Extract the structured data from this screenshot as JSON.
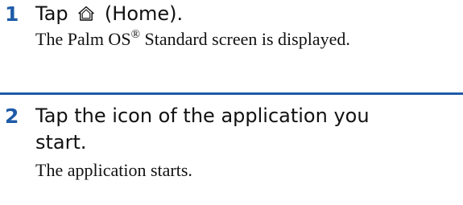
{
  "steps": [
    {
      "number": "1",
      "instruction_prefix": "Tap",
      "instruction_suffix": "(Home).",
      "result_before_mark": "The Palm OS",
      "result_mark": "®",
      "result_after_mark": " Standard screen is displayed.",
      "icon": "home-icon"
    },
    {
      "number": "2",
      "instruction_line1": "Tap the icon of the application you",
      "instruction_line2": "start.",
      "result": "The application starts."
    }
  ],
  "colors": {
    "accent": "#1e5ba8",
    "text": "#111111"
  }
}
